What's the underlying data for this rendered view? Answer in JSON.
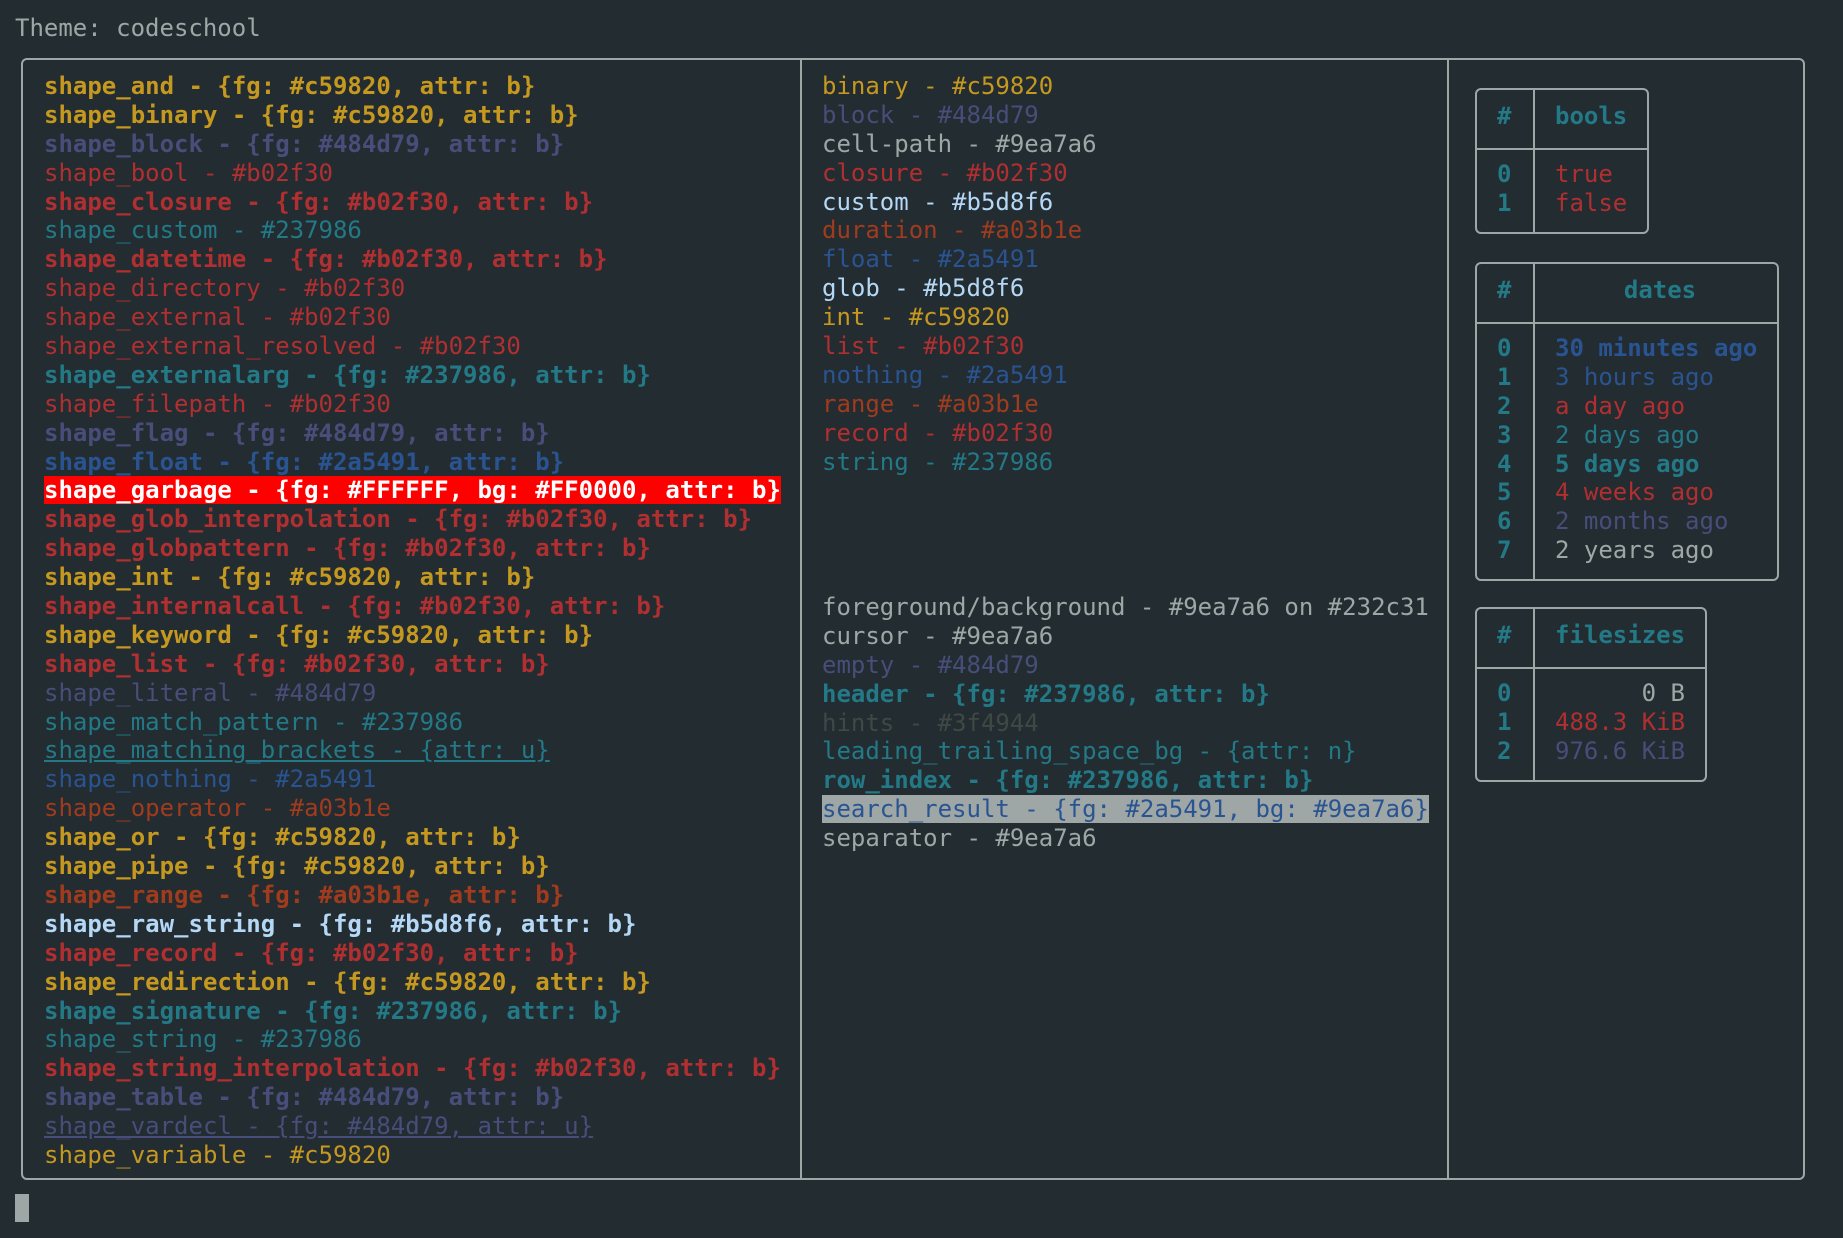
{
  "title": "Theme: codeschool",
  "shapes": [
    {
      "name": "shape_and",
      "val": "{fg: #c59820, attr: b}",
      "fg": "#c59820",
      "bold": true
    },
    {
      "name": "shape_binary",
      "val": "{fg: #c59820, attr: b}",
      "fg": "#c59820",
      "bold": true
    },
    {
      "name": "shape_block",
      "val": "{fg: #484d79, attr: b}",
      "fg": "#484d79",
      "bold": true
    },
    {
      "name": "shape_bool",
      "val": "#b02f30",
      "fg": "#b02f30"
    },
    {
      "name": "shape_closure",
      "val": "{fg: #b02f30, attr: b}",
      "fg": "#b02f30",
      "bold": true
    },
    {
      "name": "shape_custom",
      "val": "#237986",
      "fg": "#237986"
    },
    {
      "name": "shape_datetime",
      "val": "{fg: #b02f30, attr: b}",
      "fg": "#b02f30",
      "bold": true
    },
    {
      "name": "shape_directory",
      "val": "#b02f30",
      "fg": "#b02f30"
    },
    {
      "name": "shape_external",
      "val": "#b02f30",
      "fg": "#b02f30"
    },
    {
      "name": "shape_external_resolved",
      "val": "#b02f30",
      "fg": "#b02f30"
    },
    {
      "name": "shape_externalarg",
      "val": "{fg: #237986, attr: b}",
      "fg": "#237986",
      "bold": true
    },
    {
      "name": "shape_filepath",
      "val": "#b02f30",
      "fg": "#b02f30"
    },
    {
      "name": "shape_flag",
      "val": "{fg: #484d79, attr: b}",
      "fg": "#484d79",
      "bold": true
    },
    {
      "name": "shape_float",
      "val": "{fg: #2a5491, attr: b}",
      "fg": "#2a5491",
      "bold": true
    },
    {
      "name": "shape_garbage",
      "val": "{fg: #FFFFFF, bg: #FF0000, attr: b}",
      "fg": "#FFFFFF",
      "bg": "#FF0000",
      "bold": true
    },
    {
      "name": "shape_glob_interpolation",
      "val": "{fg: #b02f30, attr: b}",
      "fg": "#b02f30",
      "bold": true
    },
    {
      "name": "shape_globpattern",
      "val": "{fg: #b02f30, attr: b}",
      "fg": "#b02f30",
      "bold": true
    },
    {
      "name": "shape_int",
      "val": "{fg: #c59820, attr: b}",
      "fg": "#c59820",
      "bold": true
    },
    {
      "name": "shape_internalcall",
      "val": "{fg: #b02f30, attr: b}",
      "fg": "#b02f30",
      "bold": true
    },
    {
      "name": "shape_keyword",
      "val": "{fg: #c59820, attr: b}",
      "fg": "#c59820",
      "bold": true
    },
    {
      "name": "shape_list",
      "val": "{fg: #b02f30, attr: b}",
      "fg": "#b02f30",
      "bold": true
    },
    {
      "name": "shape_literal",
      "val": "#484d79",
      "fg": "#484d79"
    },
    {
      "name": "shape_match_pattern",
      "val": "#237986",
      "fg": "#237986"
    },
    {
      "name": "shape_matching_brackets",
      "val": "{attr: u}",
      "fg": "#237986",
      "underline": true
    },
    {
      "name": "shape_nothing",
      "val": "#2a5491",
      "fg": "#2a5491"
    },
    {
      "name": "shape_operator",
      "val": "#a03b1e",
      "fg": "#a03b1e"
    },
    {
      "name": "shape_or",
      "val": "{fg: #c59820, attr: b}",
      "fg": "#c59820",
      "bold": true
    },
    {
      "name": "shape_pipe",
      "val": "{fg: #c59820, attr: b}",
      "fg": "#c59820",
      "bold": true
    },
    {
      "name": "shape_range",
      "val": "{fg: #a03b1e, attr: b}",
      "fg": "#a03b1e",
      "bold": true
    },
    {
      "name": "shape_raw_string",
      "val": "{fg: #b5d8f6, attr: b}",
      "fg": "#b5d8f6",
      "bold": true
    },
    {
      "name": "shape_record",
      "val": "{fg: #b02f30, attr: b}",
      "fg": "#b02f30",
      "bold": true
    },
    {
      "name": "shape_redirection",
      "val": "{fg: #c59820, attr: b}",
      "fg": "#c59820",
      "bold": true
    },
    {
      "name": "shape_signature",
      "val": "{fg: #237986, attr: b}",
      "fg": "#237986",
      "bold": true
    },
    {
      "name": "shape_string",
      "val": "#237986",
      "fg": "#237986"
    },
    {
      "name": "shape_string_interpolation",
      "val": "{fg: #b02f30, attr: b}",
      "fg": "#b02f30",
      "bold": true
    },
    {
      "name": "shape_table",
      "val": "{fg: #484d79, attr: b}",
      "fg": "#484d79",
      "bold": true
    },
    {
      "name": "shape_vardecl",
      "val": "{fg: #484d79, attr: u}",
      "fg": "#484d79",
      "underline": true
    },
    {
      "name": "shape_variable",
      "val": "#c59820",
      "fg": "#c59820"
    }
  ],
  "types": [
    {
      "name": "binary",
      "val": "#c59820",
      "fg": "#c59820"
    },
    {
      "name": "block",
      "val": "#484d79",
      "fg": "#484d79"
    },
    {
      "name": "cell-path",
      "val": "#9ea7a6",
      "fg": "#9ea7a6"
    },
    {
      "name": "closure",
      "val": "#b02f30",
      "fg": "#b02f30"
    },
    {
      "name": "custom",
      "val": "#b5d8f6",
      "fg": "#b5d8f6"
    },
    {
      "name": "duration",
      "val": "#a03b1e",
      "fg": "#a03b1e"
    },
    {
      "name": "float",
      "val": "#2a5491",
      "fg": "#2a5491"
    },
    {
      "name": "glob",
      "val": "#b5d8f6",
      "fg": "#b5d8f6"
    },
    {
      "name": "int",
      "val": "#c59820",
      "fg": "#c59820"
    },
    {
      "name": "list",
      "val": "#b02f30",
      "fg": "#b02f30"
    },
    {
      "name": "nothing",
      "val": "#2a5491",
      "fg": "#2a5491"
    },
    {
      "name": "range",
      "val": "#a03b1e",
      "fg": "#a03b1e"
    },
    {
      "name": "record",
      "val": "#b02f30",
      "fg": "#b02f30"
    },
    {
      "name": "string",
      "val": "#237986",
      "fg": "#237986"
    }
  ],
  "ui": [
    {
      "name": "foreground/background",
      "val": "#9ea7a6 on #232c31",
      "fg": "#9ea7a6"
    },
    {
      "name": "cursor",
      "val": "#9ea7a6",
      "fg": "#9ea7a6"
    },
    {
      "name": "empty",
      "val": "#484d79",
      "fg": "#484d79"
    },
    {
      "name": "header",
      "val": "{fg: #237986, attr: b}",
      "fg": "#237986",
      "bold": true
    },
    {
      "name": "hints",
      "val": "#3f4944",
      "fg": "#3f4944"
    },
    {
      "name": "leading_trailing_space_bg",
      "val": "{attr: n}",
      "fg": "#237986"
    },
    {
      "name": "row_index",
      "val": "{fg: #237986, attr: b}",
      "fg": "#237986",
      "bold": true
    },
    {
      "name": "search_result",
      "val": "{fg: #2a5491, bg: #9ea7a6}",
      "fg": "#2a5491",
      "bg": "#9ea7a6"
    },
    {
      "name": "separator",
      "val": "#9ea7a6",
      "fg": "#9ea7a6"
    }
  ],
  "bools": {
    "hash": "#",
    "header": "bools",
    "rows": [
      {
        "idx": "0",
        "val": "true",
        "fg": "#b02f30"
      },
      {
        "idx": "1",
        "val": "false",
        "fg": "#b02f30"
      }
    ]
  },
  "dates": {
    "hash": "#",
    "header": "dates",
    "rows": [
      {
        "idx": "0",
        "val": "30 minutes ago",
        "fg": "#2a5491",
        "bold": true
      },
      {
        "idx": "1",
        "val": "3 hours ago",
        "fg": "#2a5491"
      },
      {
        "idx": "2",
        "val": "a day ago",
        "fg": "#b02f30"
      },
      {
        "idx": "3",
        "val": "2 days ago",
        "fg": "#237986"
      },
      {
        "idx": "4",
        "val": "5 days ago",
        "fg": "#237986",
        "bold": true
      },
      {
        "idx": "5",
        "val": "4 weeks ago",
        "fg": "#b02f30"
      },
      {
        "idx": "6",
        "val": "2 months ago",
        "fg": "#484d79"
      },
      {
        "idx": "7",
        "val": "2 years ago",
        "fg": "#9ea7a6"
      }
    ]
  },
  "filesizes": {
    "hash": "#",
    "header": "filesizes",
    "rows": [
      {
        "idx": "0",
        "val": "0 B",
        "fg": "#9ea7a6"
      },
      {
        "idx": "1",
        "val": "488.3 KiB",
        "fg": "#b02f30"
      },
      {
        "idx": "2",
        "val": "976.6 KiB",
        "fg": "#484d79"
      }
    ]
  },
  "colors": {
    "background": "#232c31",
    "foreground": "#9ea7a6",
    "header": "#237986"
  }
}
